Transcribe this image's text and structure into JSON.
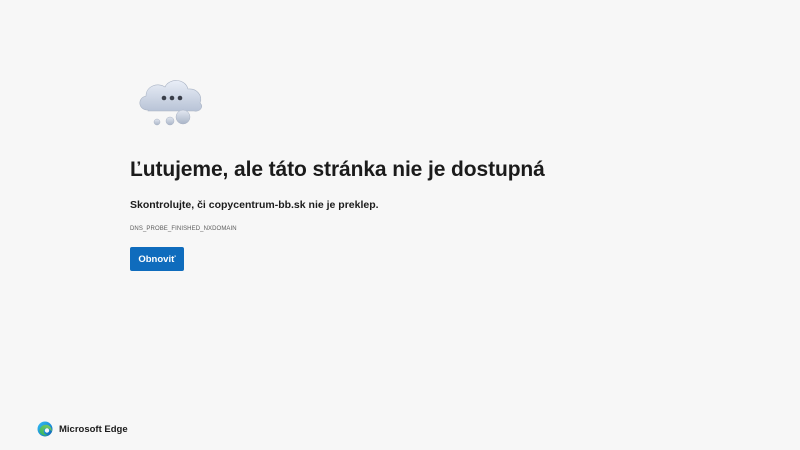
{
  "error_page": {
    "icon": "cloud-thinking-icon",
    "title": "Ľutujeme, ale táto stránka nie je dostupná",
    "subtitle": "Skontrolujte, či copycentrum-bb.sk nie je preklep.",
    "error_code": "DNS_PROBE_FINISHED_NXDOMAIN",
    "reload_label": "Obnoviť"
  },
  "footer": {
    "logo_icon": "microsoft-edge-logo-icon",
    "brand_name": "Microsoft Edge"
  },
  "colors": {
    "background": "#f7f7f7",
    "accent": "#0f6cbd",
    "text": "#1b1b1b"
  }
}
